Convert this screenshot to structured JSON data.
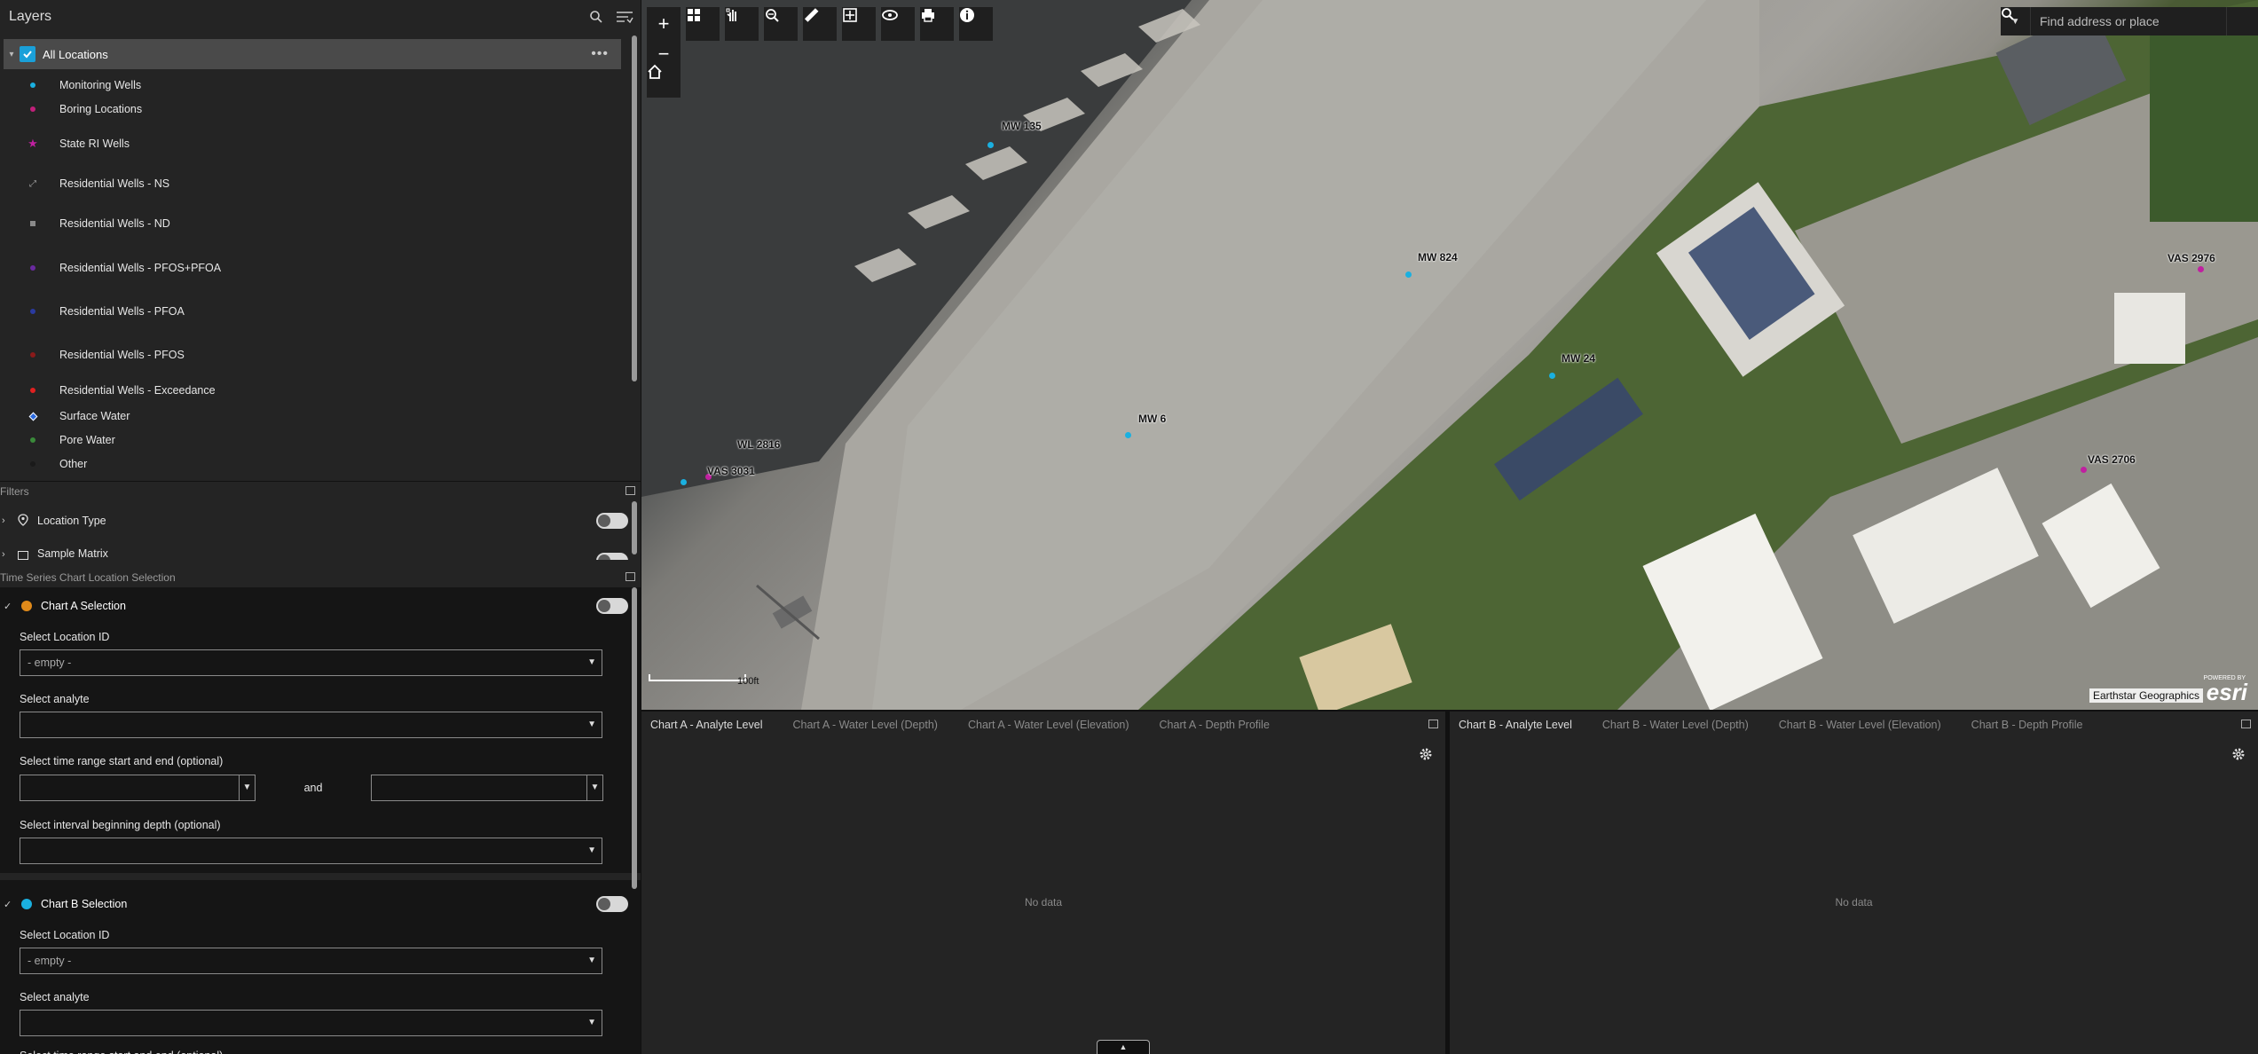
{
  "layers": {
    "title": "Layers",
    "all_label": "All Locations",
    "items": [
      {
        "label": "Monitoring Wells",
        "color": "#1ab0e0",
        "shape": "dot"
      },
      {
        "label": "Boring Locations",
        "color": "#c0207a",
        "shape": "dot"
      },
      {
        "label": "State RI Wells",
        "color": "#c020a0",
        "shape": "star"
      },
      {
        "label": "Residential Wells - NS",
        "color": "#aaaaaa",
        "shape": "check"
      },
      {
        "label": "Residential Wells - ND",
        "color": "#8a8a8a",
        "shape": "square"
      },
      {
        "label": "Residential Wells - PFOS+PFOA",
        "color": "#6a2aa0",
        "shape": "dot"
      },
      {
        "label": "Residential Wells - PFOA",
        "color": "#2a3aa0",
        "shape": "dot"
      },
      {
        "label": "Residential Wells - PFOS",
        "color": "#8a1a1a",
        "shape": "dot"
      },
      {
        "label": "Residential Wells - Exceedance",
        "color": "#e02020",
        "shape": "dot"
      },
      {
        "label": "Surface Water",
        "color": "#2a6ae0",
        "shape": "diamond"
      },
      {
        "label": "Pore Water",
        "color": "#3a8a3a",
        "shape": "dot"
      },
      {
        "label": "Other",
        "color": "#1a1a1a",
        "shape": "dot"
      }
    ]
  },
  "filters": {
    "title": "Filters",
    "items": [
      {
        "label": "Location Type"
      },
      {
        "label": "Sample Matrix"
      }
    ]
  },
  "timeseries": {
    "title": "Time Series Chart Location Selection",
    "chart_a": {
      "label": "Chart A Selection",
      "icon_color": "#e08a1a",
      "location_label": "Select Location ID",
      "location_value": "- empty -",
      "analyte_label": "Select analyte",
      "time_label": "Select time range start and end (optional)",
      "and_label": "and",
      "depth_label": "Select interval beginning depth (optional)"
    },
    "chart_b": {
      "label": "Chart B Selection",
      "icon_color": "#1ab0e0",
      "location_label": "Select Location ID",
      "location_value": "- empty -",
      "analyte_label": "Select analyte",
      "time_label": "Select time range start and end (optional)"
    }
  },
  "map": {
    "search_placeholder": "Find address or place",
    "attribution": "Earthstar Geographics",
    "powered_by": "POWERED BY",
    "esri": "esri",
    "scale": "100ft",
    "labels": {
      "mw135": "MW 135",
      "mw824": "MW 824",
      "mw24": "MW 24",
      "mw6": "MW 6",
      "wl2816": "WL 2816",
      "vas3031": "VAS 3031",
      "vas2706": "VAS 2706",
      "vas2976": "VAS 2976"
    }
  },
  "chart_a": {
    "tabs": [
      "Chart A - Analyte Level",
      "Chart A - Water Level (Depth)",
      "Chart A - Water Level (Elevation)",
      "Chart A - Depth Profile"
    ],
    "no_data": "No data"
  },
  "chart_b": {
    "tabs": [
      "Chart B - Analyte Level",
      "Chart B - Water Level (Depth)",
      "Chart B - Water Level (Elevation)",
      "Chart B - Depth Profile"
    ],
    "no_data": "No data"
  }
}
